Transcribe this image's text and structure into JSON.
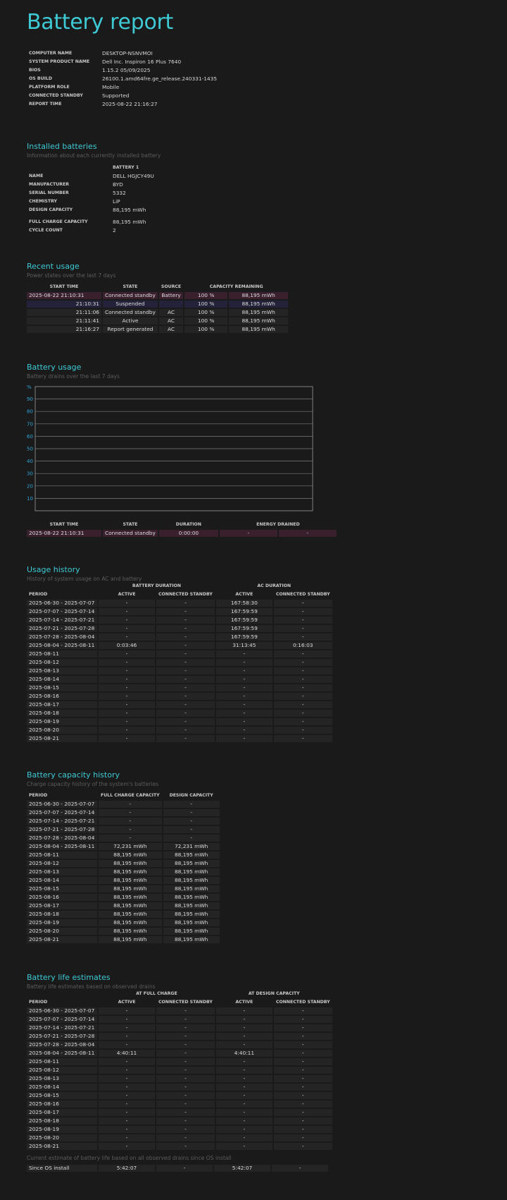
{
  "title": "Battery report",
  "system_info": [
    {
      "key": "COMPUTER NAME",
      "value": "DESKTOP-NSNVMOI"
    },
    {
      "key": "SYSTEM PRODUCT NAME",
      "value": "Dell Inc. Inspiron 16 Plus 7640"
    },
    {
      "key": "BIOS",
      "value": "1.15.2 05/09/2025"
    },
    {
      "key": "OS BUILD",
      "value": "26100.1.amd64fre.ge_release.240331-1435"
    },
    {
      "key": "PLATFORM ROLE",
      "value": "Mobile"
    },
    {
      "key": "CONNECTED STANDBY",
      "value": "Supported"
    },
    {
      "key": "REPORT TIME",
      "value": "2025-08-22  21:16:27"
    }
  ],
  "installed": {
    "title": "Installed batteries",
    "subtitle": "Information about each currently installed battery",
    "column": "BATTERY 1",
    "rows": [
      {
        "key": "NAME",
        "value": "DELL HGJCY49U"
      },
      {
        "key": "MANUFACTURER",
        "value": "BYD"
      },
      {
        "key": "SERIAL NUMBER",
        "value": "5332"
      },
      {
        "key": "CHEMISTRY",
        "value": "LiP"
      },
      {
        "key": "DESIGN CAPACITY",
        "value": "88,195 mWh"
      },
      {
        "key": "FULL CHARGE CAPACITY",
        "value": "88,195 mWh"
      },
      {
        "key": "CYCLE COUNT",
        "value": "2"
      }
    ]
  },
  "recent": {
    "title": "Recent usage",
    "subtitle": "Power states over the last 7 days",
    "headers": [
      "START TIME",
      "STATE",
      "SOURCE",
      "CAPACITY REMAINING"
    ],
    "rows": [
      [
        "2025-08-22  21:10:31",
        "Connected standby",
        "Battery",
        "100 %",
        "88,195 mWh"
      ],
      [
        "21:10:31",
        "Suspended",
        "",
        "100 %",
        "88,195 mWh"
      ],
      [
        "21:11:06",
        "Connected standby",
        "AC",
        "100 %",
        "88,195 mWh"
      ],
      [
        "21:11:41",
        "Active",
        "AC",
        "100 %",
        "88,195 mWh"
      ],
      [
        "21:16:27",
        "Report generated",
        "AC",
        "100 %",
        "88,195 mWh"
      ]
    ]
  },
  "battery_usage": {
    "title": "Battery usage",
    "subtitle": "Battery drains over the last 7 days",
    "chart_data": {
      "type": "area",
      "ylabel": "%",
      "yticks": [
        10,
        20,
        30,
        40,
        50,
        60,
        70,
        80,
        90
      ],
      "ylim": [
        0,
        100
      ],
      "grid": true,
      "series": []
    },
    "headers": [
      "START TIME",
      "STATE",
      "DURATION",
      "ENERGY DRAINED"
    ],
    "rows": [
      [
        "2025-08-22  21:10:31",
        "Connected standby",
        "0:00:00",
        "-",
        "-"
      ]
    ]
  },
  "usage_history": {
    "title": "Usage history",
    "subtitle": "History of system usage on AC and battery",
    "group1": "BATTERY DURATION",
    "group2": "AC DURATION",
    "headers": [
      "PERIOD",
      "ACTIVE",
      "CONNECTED STANDBY",
      "ACTIVE",
      "CONNECTED STANDBY"
    ],
    "rows": [
      [
        "2025-06-30 - 2025-07-07",
        "-",
        "-",
        "167:58:30",
        "-"
      ],
      [
        "2025-07-07 - 2025-07-14",
        "-",
        "-",
        "167:59:59",
        "-"
      ],
      [
        "2025-07-14 - 2025-07-21",
        "-",
        "-",
        "167:59:59",
        "-"
      ],
      [
        "2025-07-21 - 2025-07-28",
        "-",
        "-",
        "167:59:59",
        "-"
      ],
      [
        "2025-07-28 - 2025-08-04",
        "-",
        "-",
        "167:59:59",
        "-"
      ],
      [
        "2025-08-04 - 2025-08-11",
        "0:03:46",
        "-",
        "31:13:45",
        "0:16:03"
      ],
      [
        "2025-08-11",
        "-",
        "-",
        "-",
        "-"
      ],
      [
        "2025-08-12",
        "-",
        "-",
        "-",
        "-"
      ],
      [
        "2025-08-13",
        "-",
        "-",
        "-",
        "-"
      ],
      [
        "2025-08-14",
        "-",
        "-",
        "-",
        "-"
      ],
      [
        "2025-08-15",
        "-",
        "-",
        "-",
        "-"
      ],
      [
        "2025-08-16",
        "-",
        "-",
        "-",
        "-"
      ],
      [
        "2025-08-17",
        "-",
        "-",
        "-",
        "-"
      ],
      [
        "2025-08-18",
        "-",
        "-",
        "-",
        "-"
      ],
      [
        "2025-08-19",
        "-",
        "-",
        "-",
        "-"
      ],
      [
        "2025-08-20",
        "-",
        "-",
        "-",
        "-"
      ],
      [
        "2025-08-21",
        "-",
        "-",
        "-",
        "-"
      ]
    ]
  },
  "capacity_history": {
    "title": "Battery capacity history",
    "subtitle": "Charge capacity history of the system's batteries",
    "headers": [
      "PERIOD",
      "FULL CHARGE CAPACITY",
      "DESIGN CAPACITY"
    ],
    "rows": [
      [
        "2025-06-30 - 2025-07-07",
        "-",
        "-"
      ],
      [
        "2025-07-07 - 2025-07-14",
        "-",
        "-"
      ],
      [
        "2025-07-14 - 2025-07-21",
        "-",
        "-"
      ],
      [
        "2025-07-21 - 2025-07-28",
        "-",
        "-"
      ],
      [
        "2025-07-28 - 2025-08-04",
        "-",
        "-"
      ],
      [
        "2025-08-04 - 2025-08-11",
        "72,231 mWh",
        "72,231 mWh"
      ],
      [
        "2025-08-11",
        "88,195 mWh",
        "88,195 mWh"
      ],
      [
        "2025-08-12",
        "88,195 mWh",
        "88,195 mWh"
      ],
      [
        "2025-08-13",
        "88,195 mWh",
        "88,195 mWh"
      ],
      [
        "2025-08-14",
        "88,195 mWh",
        "88,195 mWh"
      ],
      [
        "2025-08-15",
        "88,195 mWh",
        "88,195 mWh"
      ],
      [
        "2025-08-16",
        "88,195 mWh",
        "88,195 mWh"
      ],
      [
        "2025-08-17",
        "88,195 mWh",
        "88,195 mWh"
      ],
      [
        "2025-08-18",
        "88,195 mWh",
        "88,195 mWh"
      ],
      [
        "2025-08-19",
        "88,195 mWh",
        "88,195 mWh"
      ],
      [
        "2025-08-20",
        "88,195 mWh",
        "88,195 mWh"
      ],
      [
        "2025-08-21",
        "88,195 mWh",
        "88,195 mWh"
      ]
    ]
  },
  "life_estimates": {
    "title": "Battery life estimates",
    "subtitle": "Battery life estimates based on observed drains",
    "group1": "AT FULL CHARGE",
    "group2": "AT DESIGN CAPACITY",
    "headers": [
      "PERIOD",
      "ACTIVE",
      "CONNECTED STANDBY",
      "ACTIVE",
      "CONNECTED STANDBY"
    ],
    "rows": [
      [
        "2025-06-30 - 2025-07-07",
        "-",
        "-",
        "-",
        "-"
      ],
      [
        "2025-07-07 - 2025-07-14",
        "-",
        "-",
        "-",
        "-"
      ],
      [
        "2025-07-14 - 2025-07-21",
        "-",
        "-",
        "-",
        "-"
      ],
      [
        "2025-07-21 - 2025-07-28",
        "-",
        "-",
        "-",
        "-"
      ],
      [
        "2025-07-28 - 2025-08-04",
        "-",
        "-",
        "-",
        "-"
      ],
      [
        "2025-08-04 - 2025-08-11",
        "4:40:11",
        "-",
        "4:40:11",
        "-"
      ],
      [
        "2025-08-11",
        "-",
        "-",
        "-",
        "-"
      ],
      [
        "2025-08-12",
        "-",
        "-",
        "-",
        "-"
      ],
      [
        "2025-08-13",
        "-",
        "-",
        "-",
        "-"
      ],
      [
        "2025-08-14",
        "-",
        "-",
        "-",
        "-"
      ],
      [
        "2025-08-15",
        "-",
        "-",
        "-",
        "-"
      ],
      [
        "2025-08-16",
        "-",
        "-",
        "-",
        "-"
      ],
      [
        "2025-08-17",
        "-",
        "-",
        "-",
        "-"
      ],
      [
        "2025-08-18",
        "-",
        "-",
        "-",
        "-"
      ],
      [
        "2025-08-19",
        "-",
        "-",
        "-",
        "-"
      ],
      [
        "2025-08-20",
        "-",
        "-",
        "-",
        "-"
      ],
      [
        "2025-08-21",
        "-",
        "-",
        "-",
        "-"
      ]
    ],
    "current_note": "Current estimate of battery life based on all observed drains since OS install",
    "current_row": [
      "Since OS install",
      "5:42:07",
      "-",
      "5:42:07",
      "-"
    ]
  }
}
